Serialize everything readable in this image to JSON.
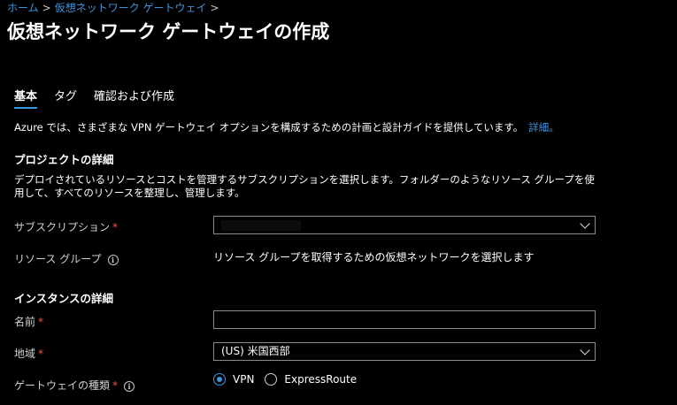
{
  "breadcrumb": {
    "home": "ホーム",
    "separator": ">",
    "parent": "仮想ネットワーク ゲートウェイ"
  },
  "page_title": "仮想ネットワーク ゲートウェイの作成",
  "tabs": [
    {
      "label": "基本",
      "active": true
    },
    {
      "label": "タグ",
      "active": false
    },
    {
      "label": "確認および作成",
      "active": false
    }
  ],
  "info": {
    "text": "Azure では、さまざまな VPN ゲートウェイ オプションを構成するための計画と設計ガイドを提供しています。",
    "link": "詳細。"
  },
  "project": {
    "title": "プロジェクトの詳細",
    "description": "デプロイされているリソースとコストを管理するサブスクリプションを選択します。フォルダーのようなリソース グループを使用して、すべてのリソースを整理し、管理します。",
    "subscription_label": "サブスクリプション",
    "resource_group_label": "リソース グループ",
    "resource_group_value": "リソース グループを取得するための仮想ネットワークを選択します"
  },
  "instance": {
    "title": "インスタンスの詳細",
    "name_label": "名前",
    "name_value": "",
    "region_label": "地域",
    "region_value": "(US) 米国西部",
    "gateway_type_label": "ゲートウェイの種類",
    "gateway_types": [
      "VPN",
      "ExpressRoute"
    ]
  },
  "required_mark": "*",
  "colors": {
    "accent": "#3a96dd",
    "required": "#ff5050",
    "background": "#000000"
  }
}
